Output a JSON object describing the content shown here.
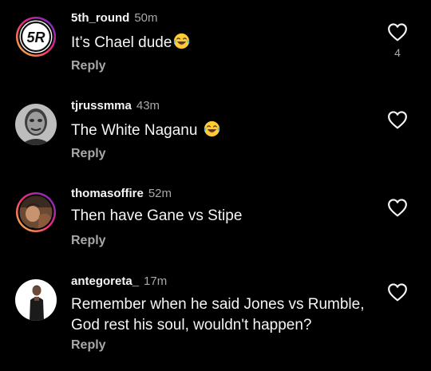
{
  "comments": [
    {
      "username": "5th_round",
      "time": "50m",
      "text": "It’s Chael dude",
      "emoji": "laughing-tears",
      "reply_label": "Reply",
      "like_count": "4",
      "avatar_text": "5R",
      "avatar_icon": "5th-round-logo-avatar"
    },
    {
      "username": "tjrussmma",
      "time": "43m",
      "text": "The White Naganu ",
      "emoji": "laughing-tears",
      "reply_label": "Reply",
      "avatar_icon": "user-photo-avatar"
    },
    {
      "username": "thomasoffire",
      "time": "52m",
      "text": "Then have Gane vs Stipe",
      "reply_label": "Reply",
      "avatar_icon": "story-ring-avatar"
    },
    {
      "username": "antegoreta_",
      "time": "17m",
      "text_line1": "Remember when he said Jones vs Rumble,",
      "text_line2": "God rest his soul, wouldn't happen?",
      "reply_label": "Reply",
      "avatar_icon": "user-photo-avatar"
    }
  ],
  "colors": {
    "background": "#000000",
    "primary_text": "#f5f5f5",
    "secondary_text": "#a8a8a8",
    "story_ring_start": "#f9ce34",
    "story_ring_mid": "#ee2a7b",
    "story_ring_end": "#6228d7"
  }
}
